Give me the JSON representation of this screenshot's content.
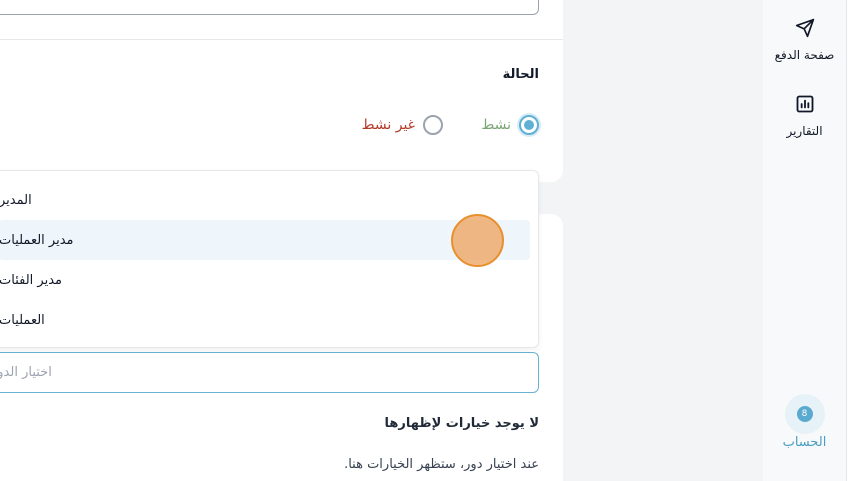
{
  "sidebar": {
    "items": [
      {
        "label": "صفحة الدفع",
        "icon": "send-icon"
      },
      {
        "label": "التقارير",
        "icon": "bar-chart-icon"
      }
    ],
    "account": {
      "label": "الحساب",
      "avatar_text": "8",
      "icon": "avatar-icon"
    }
  },
  "form": {
    "status_label": "الحالة",
    "status_options": [
      {
        "label": "نشط",
        "selected": true
      },
      {
        "label": "غير نشط",
        "selected": false
      }
    ],
    "role_menu": {
      "options": [
        "المدير",
        "مدير العمليات",
        "مدير الفئات",
        "العمليات"
      ],
      "highlighted": "مدير العمليات"
    },
    "role_select_placeholder": "اختيار الدور",
    "no_options_title": "لا يوجد خيارات لإظهارها",
    "no_options_hint": "عند اختيار دور، ستظهر الخيارات هنا."
  },
  "colors": {
    "accent": "#60b0d6",
    "active_text": "#7aa872",
    "inactive_text": "#b23b2a",
    "highlight": "#eef6fb"
  }
}
